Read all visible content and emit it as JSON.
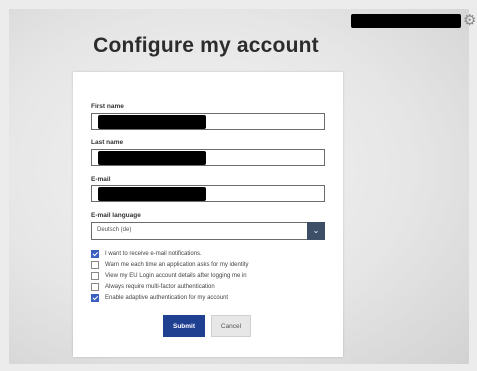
{
  "header": {
    "gear_icon": "gear-icon"
  },
  "page": {
    "title": "Configure my account"
  },
  "form": {
    "first_name_label": "First name",
    "last_name_label": "Last name",
    "email_label": "E-mail",
    "email_language_label": "E-mail language",
    "email_language_value": "Deutsch (de)",
    "options": [
      {
        "label": "I want to receive e-mail notifications.",
        "checked": true
      },
      {
        "label": "Warn me each time an application asks for my identity",
        "checked": false
      },
      {
        "label": "View my EU Login account details after logging me in",
        "checked": false
      },
      {
        "label": "Always require multi-factor authentication",
        "checked": false
      },
      {
        "label": "Enable adaptive authentication for my account",
        "checked": true
      }
    ],
    "submit_label": "Submit",
    "cancel_label": "Cancel"
  },
  "colors": {
    "primary": "#1f3f91",
    "checkbox_on": "#3a5fbf",
    "select_button": "#3d4f66"
  }
}
